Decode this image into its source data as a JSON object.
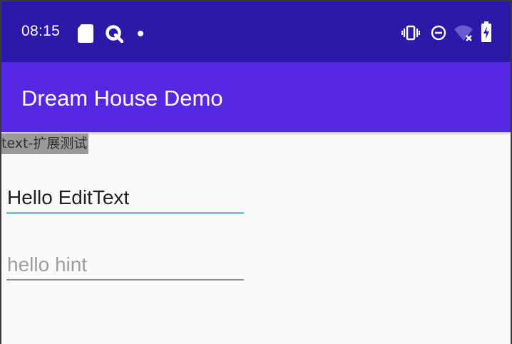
{
  "status_bar": {
    "time": "08:15",
    "left_icons": [
      "sim-card-icon",
      "assistant-q-icon",
      "notification-dot-icon"
    ],
    "right_icons": [
      "vibrate-icon",
      "do-not-disturb-icon",
      "wifi-off-icon",
      "battery-charging-icon"
    ]
  },
  "app_bar": {
    "title": "Dream House Demo"
  },
  "content": {
    "label": "text-扩展测试",
    "edit_text_value": "Hello EditText",
    "hint_placeholder": "hello hint"
  },
  "colors": {
    "status_bar": "#2c19a8",
    "app_bar": "#5627e3",
    "focused_underline": "#5fd3c9",
    "label_highlight": "#9a9a9a"
  }
}
